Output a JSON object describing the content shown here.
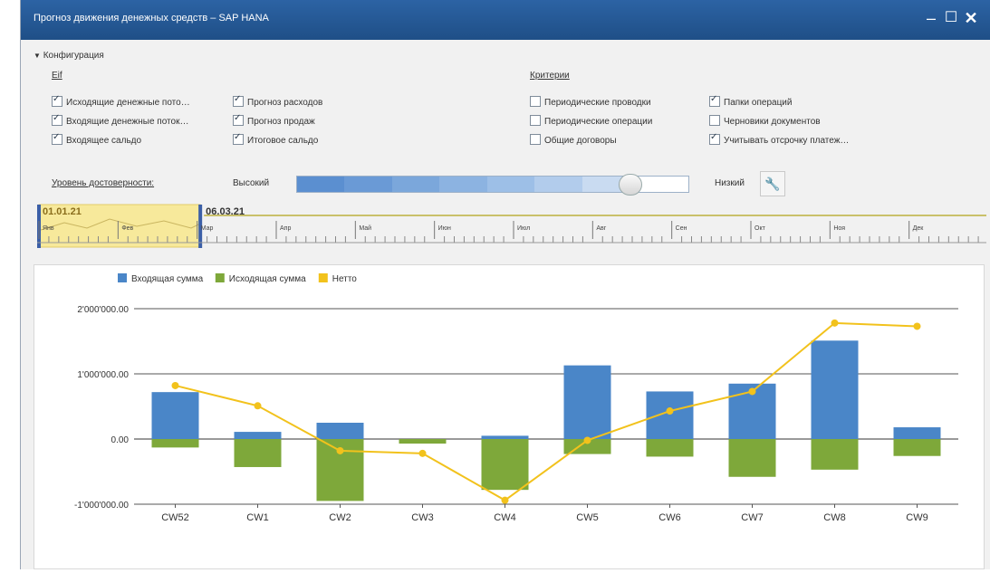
{
  "window": {
    "title": "Прогноз движения денежных средств – SAP HANA"
  },
  "config": {
    "header": "Конфигурация",
    "group_left_label": "Eif",
    "group_right_label": "Критерии",
    "checkboxes_left": [
      {
        "label": "Исходящие денежные пото…",
        "checked": true
      },
      {
        "label": "Входящие денежные поток…",
        "checked": true
      },
      {
        "label": "Входящее сальдо",
        "checked": true
      }
    ],
    "checkboxes_mid": [
      {
        "label": "Прогноз расходов",
        "checked": true
      },
      {
        "label": "Прогноз продаж",
        "checked": true
      },
      {
        "label": "Итоговое сальдо",
        "checked": true
      }
    ],
    "checkboxes_right1": [
      {
        "label": "Периодические проводки",
        "checked": false
      },
      {
        "label": "Периодические операции",
        "checked": false
      },
      {
        "label": "Общие договоры",
        "checked": false
      }
    ],
    "checkboxes_right2": [
      {
        "label": "Папки операций",
        "checked": true
      },
      {
        "label": "Черновики документов",
        "checked": false
      },
      {
        "label": "Учитывать отсрочку платеж…",
        "checked": true
      }
    ],
    "reliability_label": "Уровень достоверности:",
    "high_label": "Высокий",
    "low_label": "Низкий",
    "reliability_level": 0.85,
    "slider_colors": [
      "#5b8fd0",
      "#6a9ad6",
      "#7ba7db",
      "#8cb3e1",
      "#9dbfe7",
      "#b2ccec",
      "#c9dbf1"
    ]
  },
  "timeline": {
    "start_label": "01.01.21",
    "end_label": "06.03.21",
    "months": [
      "Янв",
      "Фев",
      "Мар",
      "Апр",
      "Май",
      "Июн",
      "Июл",
      "Авг",
      "Сен",
      "Окт",
      "Ноя",
      "Дек"
    ],
    "selection_fraction": 0.17,
    "selection_color": "#f7e99b"
  },
  "chart_data": {
    "type": "bar",
    "legend": [
      {
        "name": "Входящая сумма",
        "color": "#4a86c8"
      },
      {
        "name": "Исходящая сумма",
        "color": "#7ea83a"
      },
      {
        "name": "Нетто",
        "color": "#f2c21c"
      }
    ],
    "categories": [
      "CW52",
      "CW1",
      "CW2",
      "CW3",
      "CW4",
      "CW5",
      "CW6",
      "CW7",
      "CW8",
      "CW9"
    ],
    "series": [
      {
        "name": "Входящая сумма",
        "type": "bar",
        "color": "#4a86c8",
        "values": [
          720000,
          110000,
          250000,
          -40000,
          50000,
          1130000,
          730000,
          850000,
          1510000,
          180000
        ]
      },
      {
        "name": "Исходящая сумма",
        "type": "bar",
        "color": "#7ea83a",
        "values": [
          -130000,
          -430000,
          -950000,
          -70000,
          -780000,
          -230000,
          -270000,
          -580000,
          -470000,
          -260000
        ]
      },
      {
        "name": "Нетто",
        "type": "line",
        "color": "#f2c21c",
        "values": [
          820000,
          510000,
          -180000,
          -220000,
          -940000,
          -20000,
          430000,
          730000,
          1780000,
          1730000
        ]
      }
    ],
    "yticks": [
      "2'000'000.00",
      "1'000'000.00",
      "0.00",
      "-1'000'000.00"
    ],
    "ytick_values": [
      2000000,
      1000000,
      0,
      -1000000
    ],
    "ylim": [
      -1000000,
      2000000
    ]
  }
}
